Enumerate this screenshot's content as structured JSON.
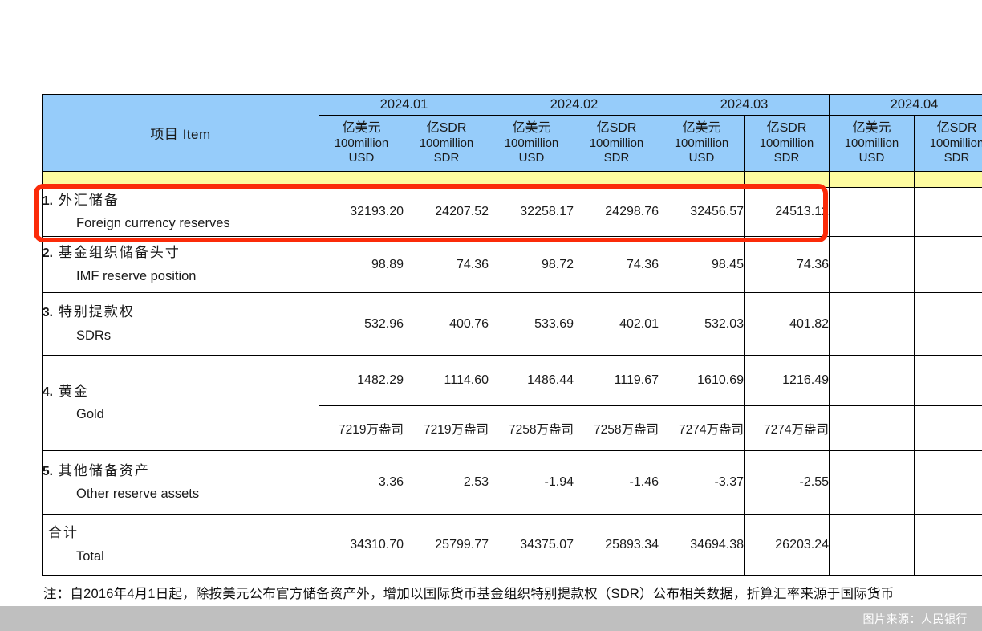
{
  "table": {
    "item_header": "项目  Item",
    "months": [
      "2024.01",
      "2024.02",
      "2024.03",
      "2024.04"
    ],
    "unit_usd": {
      "cn": "亿美元",
      "en1": "100million",
      "en2": "USD"
    },
    "unit_sdr": {
      "cn": "亿SDR",
      "en1": "100million",
      "en2": "SDR"
    },
    "rows": [
      {
        "num": "1.",
        "cn": "外汇储备",
        "en": "Foreign currency reserves",
        "values": [
          "32193.20",
          "24207.52",
          "32258.17",
          "24298.76",
          "32456.57",
          "24513.12",
          "",
          ""
        ],
        "highlighted": true
      },
      {
        "num": "2.",
        "cn": "基金组织储备头寸",
        "en": "IMF reserve position",
        "values": [
          "98.89",
          "74.36",
          "98.72",
          "74.36",
          "98.45",
          "74.36",
          "",
          ""
        ]
      },
      {
        "num": "3.",
        "cn": "特别提款权",
        "en": "SDRs",
        "values": [
          "532.96",
          "400.76",
          "533.69",
          "402.01",
          "532.03",
          "401.82",
          "",
          ""
        ]
      },
      {
        "num": "4.",
        "cn": "黄金",
        "en": "Gold",
        "values": [
          "1482.29",
          "1114.60",
          "1486.44",
          "1119.67",
          "1610.69",
          "1216.49",
          "",
          ""
        ],
        "values2": [
          "7219万盎司",
          "7219万盎司",
          "7258万盎司",
          "7258万盎司",
          "7274万盎司",
          "7274万盎司",
          "",
          ""
        ]
      },
      {
        "num": "5.",
        "cn": "其他储备资产",
        "en": "Other reserve assets",
        "values": [
          "3.36",
          "2.53",
          "-1.94",
          "-1.46",
          "-3.37",
          "-2.55",
          "",
          ""
        ]
      },
      {
        "num": "",
        "cn": "合计",
        "en": "Total",
        "values": [
          "34310.70",
          "25799.77",
          "34375.07",
          "25893.34",
          "34694.38",
          "26203.24",
          "",
          ""
        ]
      }
    ]
  },
  "footnote": "注：自2016年4月1日起，除按美元公布官方储备资产外，增加以国际货币基金组织特别提款权（SDR）公布相关数据，折算汇率来源于国际货币",
  "watermark": "图片来源：人民银行",
  "colors": {
    "header_blue": "#96ccfa",
    "spacer_yellow": "#fdfba0",
    "highlight_red": "#fb2b09",
    "watermark_bar": "#bfbfbf"
  }
}
